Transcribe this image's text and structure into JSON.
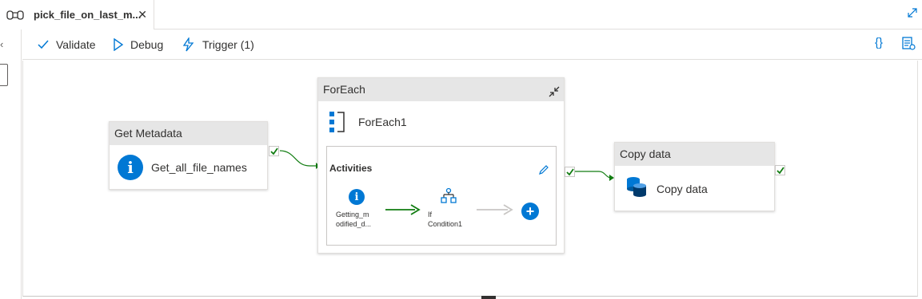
{
  "tab": {
    "title": "pick_file_on_last_m...",
    "close": "✕"
  },
  "toolbar": {
    "validate_label": "Validate",
    "debug_label": "Debug",
    "trigger_label": "Trigger (1)",
    "code_label": "{}"
  },
  "nodes": {
    "get_metadata": {
      "header": "Get Metadata",
      "name": "Get_all_file_names"
    },
    "foreach": {
      "header": "ForEach",
      "name": "ForEach1",
      "activities_title": "Activities",
      "inner": [
        {
          "label_line1": "Getting_m",
          "label_line2": "odified_d..."
        },
        {
          "label_line1": "If",
          "label_line2": "Condition1"
        }
      ]
    },
    "copy_data": {
      "header": "Copy data",
      "name": "Copy data"
    }
  },
  "colors": {
    "accent": "#0078d4",
    "success": "#107c10",
    "header_bg": "#e6e6e6",
    "inactive_arrow": "#c8c6c4"
  },
  "icons": [
    "pipeline-icon",
    "close-icon",
    "expand-icon",
    "check-icon",
    "play-icon",
    "trigger-icon",
    "code-braces-icon",
    "properties-icon",
    "info-icon",
    "foreach-icon",
    "collapse-icon",
    "edit-pencil-icon",
    "if-condition-icon",
    "plus-icon",
    "copy-data-icon"
  ]
}
